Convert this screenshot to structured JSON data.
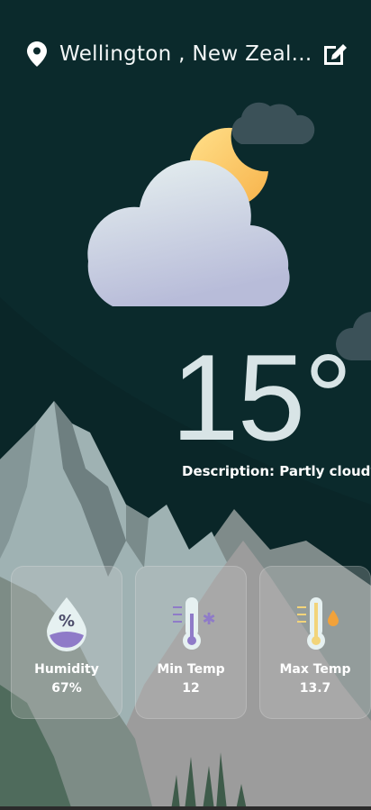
{
  "header": {
    "location": "Wellington , New Zeal...",
    "location_icon": "map-pin-icon",
    "edit_icon": "edit-icon"
  },
  "weather": {
    "temperature": "15°",
    "description": "Description: Partly cloudy",
    "condition_icon": "partly-cloudy-night-icon"
  },
  "stats": [
    {
      "label": "Humidity",
      "value": "67%",
      "icon": "humidity-drop-icon"
    },
    {
      "label": "Min Temp",
      "value": "12",
      "icon": "thermometer-cold-icon"
    },
    {
      "label": "Max Temp",
      "value": "13.7",
      "icon": "thermometer-hot-icon"
    }
  ],
  "colors": {
    "background": "#0b2a2c",
    "mountain_light": "#9fb2b3",
    "text": "#ffffff"
  }
}
